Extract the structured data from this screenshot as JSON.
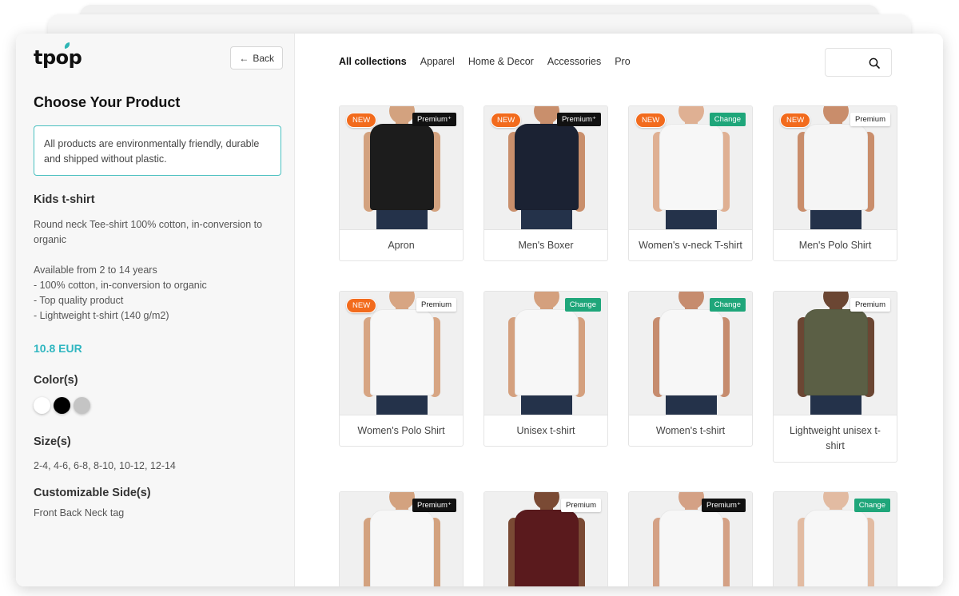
{
  "brand": {
    "name": "tpop",
    "accent": "#2fb6c0"
  },
  "sidebar": {
    "back_label": "Back",
    "title": "Choose Your Product",
    "notice": "All products are environmentally friendly, durable and shipped without plastic.",
    "product_name": "Kids t-shirt",
    "description": "Round neck Tee-shirt 100% cotton, in-conversion to organic",
    "details": [
      "Available from 2 to 14 years",
      "- 100% cotton, in-conversion to organic",
      "- Top quality product",
      "- Lightweight t-shirt (140 g/m2)"
    ],
    "price": "10.8 EUR",
    "colors_heading": "Color(s)",
    "colors": [
      "#ffffff",
      "#000000",
      "#c4c4c4"
    ],
    "sizes_heading": "Size(s)",
    "sizes": "2-4, 4-6, 6-8, 8-10, 10-12, 12-14",
    "sides_heading": "Customizable Side(s)",
    "sides": "Front Back Neck tag"
  },
  "nav": {
    "items": [
      "All collections",
      "Apparel",
      "Home & Decor",
      "Accessories",
      "Pro"
    ],
    "active": "All collections"
  },
  "search": {
    "icon": "search-icon"
  },
  "products": [
    {
      "name": "Apron",
      "new": "NEW",
      "tag": "Premium⁺",
      "tag_style": "premium-plus",
      "garment": "#1c1c1c",
      "skin": "#d3a27f"
    },
    {
      "name": "Men's Boxer",
      "new": "NEW",
      "tag": "Premium⁺",
      "tag_style": "premium-plus",
      "garment": "#1b2233",
      "skin": "#c98f6c"
    },
    {
      "name": "Women's v-neck T-shirt",
      "new": "NEW",
      "tag": "Change",
      "tag_style": "change",
      "garment": "#f7f7f7",
      "skin": "#dfb093"
    },
    {
      "name": "Men's Polo Shirt",
      "new": "NEW",
      "tag": "Premium",
      "tag_style": "premium",
      "garment": "#f5f5f5",
      "skin": "#c98d6b"
    },
    {
      "name": "Women's Polo Shirt",
      "new": "NEW",
      "tag": "Premium",
      "tag_style": "premium",
      "garment": "#f7f7f7",
      "skin": "#d7a583"
    },
    {
      "name": "Unisex t-shirt",
      "new": "",
      "tag": "Change",
      "tag_style": "change",
      "garment": "#f7f7f7",
      "skin": "#d4a07e"
    },
    {
      "name": "Women's t-shirt",
      "new": "",
      "tag": "Change",
      "tag_style": "change",
      "garment": "#f7f7f7",
      "skin": "#c68c6e"
    },
    {
      "name": "Lightweight unisex t-shirt",
      "new": "",
      "tag": "Premium",
      "tag_style": "premium",
      "garment": "#5b5f45",
      "skin": "#6b4633"
    },
    {
      "name": "",
      "new": "",
      "tag": "Premium⁺",
      "tag_style": "premium-plus",
      "garment": "#f7f7f7",
      "skin": "#d3a27f"
    },
    {
      "name": "",
      "new": "",
      "tag": "Premium",
      "tag_style": "premium",
      "garment": "#5a1a1d",
      "skin": "#7a4a34"
    },
    {
      "name": "",
      "new": "",
      "tag": "Premium⁺",
      "tag_style": "premium-plus",
      "garment": "#f7f7f7",
      "skin": "#d4a185"
    },
    {
      "name": "",
      "new": "",
      "tag": "Change",
      "tag_style": "change",
      "garment": "#f7f7f7",
      "skin": "#e2bba2"
    }
  ]
}
